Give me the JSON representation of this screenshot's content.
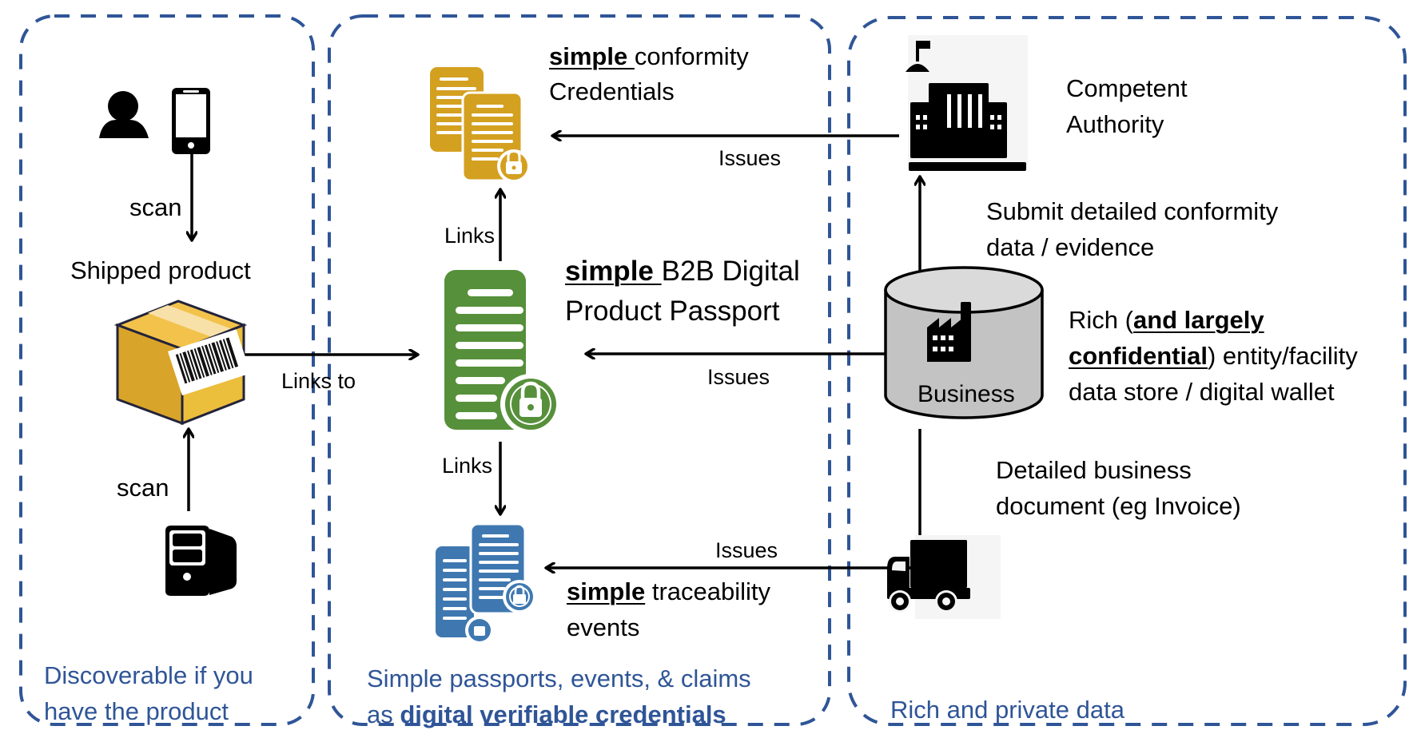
{
  "colors": {
    "zone_border": "#2F5597",
    "credential_gold": "#D4A020",
    "passport_green": "#56903A",
    "events_blue": "#3F78B0",
    "box_yellow": "#EBBE3C",
    "cylinder_gray": "#C8C8C8",
    "caption_blue": "#2F5597"
  },
  "zones": {
    "discoverable": {
      "caption_line1": "Discoverable if you",
      "caption_line2": "have the product"
    },
    "credentials": {
      "caption_line1": "Simple passports, events, & claims",
      "caption_line2_prefix": "as ",
      "caption_line2_bold": "digital verifiable credentials"
    },
    "private": {
      "caption": "Rich and  private data"
    }
  },
  "nodes": {
    "user": {
      "icon": "person-icon"
    },
    "phone": {
      "icon": "smartphone-icon"
    },
    "scanner": {
      "icon": "computer-tower-icon"
    },
    "shipped_product": {
      "label": "Shipped product",
      "icon": "barcode-box-icon"
    },
    "conformity_credentials": {
      "label_bold": "simple ",
      "label_rest": "conformity",
      "label_line2": "Credentials",
      "icon": "locked-documents-icon"
    },
    "product_passport": {
      "label_bold": "simple ",
      "label_rest": "B2B Digital",
      "label_line2": "Product Passport",
      "icon": "locked-document-icon"
    },
    "traceability_events": {
      "label_bold": "simple",
      "label_rest": " traceability",
      "label_line2": "events",
      "icon": "locked-documents-icon"
    },
    "competent_authority": {
      "label_line1": "Competent",
      "label_line2": "Authority",
      "icon": "government-building-icon"
    },
    "business": {
      "label": "Business",
      "icon": "factory-icon",
      "desc_prefix": "Rich (",
      "desc_bold1": "and largely",
      "desc_bold2": "confidential",
      "desc_rest": ") entity/facility",
      "desc_line3": "data store / digital wallet"
    },
    "truck": {
      "icon": "truck-icon"
    }
  },
  "edges": {
    "phone_scan": "scan",
    "scanner_scan": "scan",
    "links_to": "Links to",
    "links_up": "Links",
    "links_down": "Links",
    "issues_credentials": "Issues",
    "issues_passport": "Issues",
    "issues_events": "Issues",
    "submit_line1": "Submit detailed conformity",
    "submit_line2": "data / evidence",
    "invoice_line1": "Detailed business",
    "invoice_line2": "document (eg Invoice)"
  }
}
